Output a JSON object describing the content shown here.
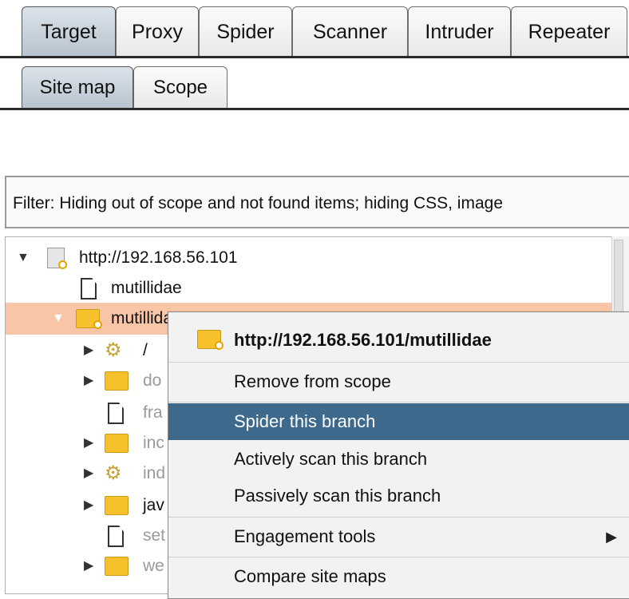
{
  "main_tabs": [
    {
      "label": "Target",
      "active": true
    },
    {
      "label": "Proxy"
    },
    {
      "label": "Spider"
    },
    {
      "label": "Scanner"
    },
    {
      "label": "Intruder"
    },
    {
      "label": "Repeater"
    }
  ],
  "sub_tabs": [
    {
      "label": "Site map",
      "active": true
    },
    {
      "label": "Scope"
    }
  ],
  "filter": {
    "text": "Filter: Hiding out of scope and not found items;  hiding CSS, image"
  },
  "tree": {
    "root": {
      "label": "http://192.168.56.101",
      "icon": "globe-folder-icon"
    },
    "items": [
      {
        "label": "mutillidae",
        "icon": "page-icon"
      },
      {
        "label": "mutillidae",
        "icon": "folder-icon",
        "selected": true
      },
      {
        "label": "/",
        "icon": "gear-icon"
      },
      {
        "label": "do",
        "icon": "folder-icon"
      },
      {
        "label": "fra",
        "icon": "page-icon"
      },
      {
        "label": "inc",
        "icon": "folder-icon"
      },
      {
        "label": "ind",
        "icon": "gear-icon"
      },
      {
        "label": "jav",
        "icon": "folder-icon"
      },
      {
        "label": "set",
        "icon": "page-icon"
      },
      {
        "label": "we",
        "icon": "folder-icon"
      }
    ]
  },
  "context_menu": {
    "header": "http://192.168.56.101/mutillidae",
    "items": [
      {
        "label": "Remove from scope"
      },
      {
        "label": "Spider this branch",
        "highlighted": true
      },
      {
        "label": "Actively scan this branch"
      },
      {
        "label": "Passively scan this branch"
      },
      {
        "label": "Engagement tools",
        "submenu": true
      },
      {
        "label": "Compare site maps"
      }
    ]
  },
  "colors": {
    "selection_bg": "#f8c6a6",
    "menu_highlight": "#3d6a8c",
    "folder": "#f6c12b"
  }
}
